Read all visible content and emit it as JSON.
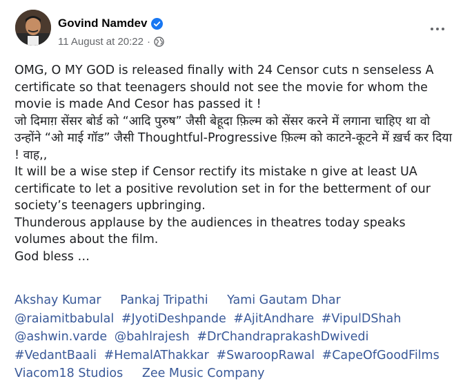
{
  "post": {
    "author": "Govind Namdev",
    "timestamp": "11 August at 20:22",
    "separator": "·",
    "verified_icon": "verified-badge-icon",
    "privacy_icon": "globe-icon",
    "more_icon": "more-options-icon",
    "paragraphs": [
      "OMG, O MY GOD is released finally with 24 Censor cuts n senseless A certificate so that teenagers should not see the movie for whom the movie is made And Cesor has passed it !",
      "जो दिमाग़ सेंसर बोर्ड को “आदि पुरुष” जैसी बेहूदा फ़िल्म को सेंसर करने में लगाना चाहिए था वो उन्होंने “ओ माई गॉड” जैसी Thoughtful-Progressive फ़िल्म को काटने-कूटने में ख़र्च कर दिया ! वाह,,",
      "It will be a wise step if Censor rectify its mistake n give at least UA certificate to let a positive revolution set in for the betterment of our society’s teenagers upbringing.",
      "Thunderous applause by the audiences in theatres today speaks volumes about the film.",
      "God bless …"
    ],
    "tags": [
      {
        "text": "Akshay Kumar",
        "kind": "person"
      },
      {
        "text": "Pankaj Tripathi",
        "kind": "person"
      },
      {
        "text": "Yami Gautam Dhar",
        "kind": "person"
      },
      {
        "text": "@raiamitbabulal",
        "kind": "hash"
      },
      {
        "text": "#JyotiDeshpande",
        "kind": "hash"
      },
      {
        "text": "#AjitAndhare",
        "kind": "hash"
      },
      {
        "text": "#VipulDShah",
        "kind": "hash"
      },
      {
        "text": "@ashwin.varde",
        "kind": "hash"
      },
      {
        "text": "@bahlrajesh",
        "kind": "hash"
      },
      {
        "text": "#DrChandraprakashDwivedi",
        "kind": "hash"
      },
      {
        "text": "#VedantBaali",
        "kind": "hash"
      },
      {
        "text": "#HemalAThakkar",
        "kind": "hash"
      },
      {
        "text": "#SwaroopRawal",
        "kind": "hash"
      },
      {
        "text": "#CapeOfGoodFilms",
        "kind": "hash"
      },
      {
        "text": "Viacom18 Studios",
        "kind": "person"
      },
      {
        "text": "Zee Music Company",
        "kind": "person"
      }
    ]
  },
  "colors": {
    "link": "#385898",
    "meta": "#65676b",
    "verified": "#1877f2"
  }
}
